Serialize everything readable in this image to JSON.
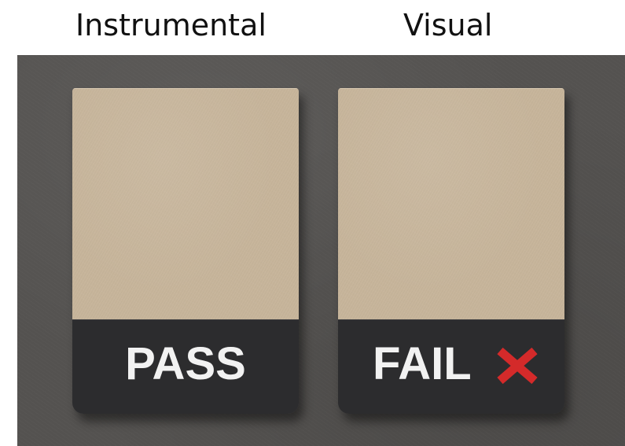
{
  "headings": {
    "instrumental": "Instrumental",
    "visual": "Visual"
  },
  "swatches": [
    {
      "result": "PASS",
      "sample_color": "#c7b59b",
      "band_color": "#2c2c2e"
    },
    {
      "result": "FAIL",
      "sample_color": "#c7b59b",
      "band_color": "#2c2c2e",
      "icon": "cross-icon",
      "icon_color": "#d42a2a"
    }
  ],
  "colors": {
    "backdrop": "#545250",
    "label_text": "#f2f2f2"
  }
}
